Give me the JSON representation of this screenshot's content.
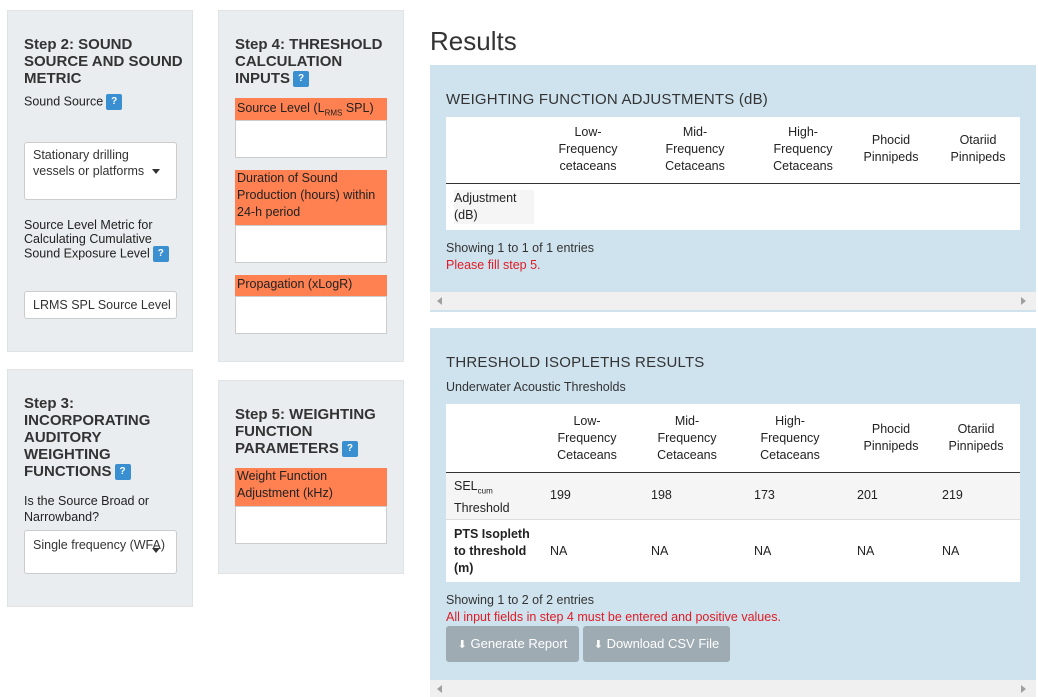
{
  "step2": {
    "title": "Step 2: SOUND SOURCE AND SOUND METRIC",
    "sound_source_label": "Sound Source",
    "sound_source_value": "Stationary drilling vessels or platforms",
    "metric_label": "Source Level Metric for Calculating Cumulative Sound Exposure Level",
    "metric_value": "LRMS SPL Source Level"
  },
  "step3": {
    "title": "Step 3: INCORPORATING AUDITORY WEIGHTING FUNCTIONS",
    "question": "Is the Source Broad or Narrowband?",
    "value": "Single frequency (WFA)"
  },
  "step4": {
    "title": "Step 4: THRESHOLD CALCULATION INPUTS",
    "source_level_label": "Source Level (L",
    "source_level_sub": "RMS",
    "source_level_suffix": " SPL)",
    "duration_label": "Duration of Sound Production (hours) within 24-h period",
    "propagation_label": "Propagation (xLogR)",
    "source_level_value": "",
    "duration_value": "",
    "propagation_value": ""
  },
  "step5": {
    "title": "Step 5: WEIGHTING FUNCTION PARAMETERS",
    "weight_label": "Weight Function Adjustment (kHz)",
    "weight_value": ""
  },
  "help_glyph": "?",
  "results": {
    "title": "Results",
    "weighting": {
      "heading": "WEIGHTING FUNCTION ADJUSTMENTS (dB)",
      "columns": [
        "Low-Frequency cetaceans",
        "Mid-Frequency Cetaceans",
        "High-Frequency Cetaceans",
        "Phocid Pinnipeds",
        "Otariid Pinnipeds"
      ],
      "row_label": "Adjustment (dB)",
      "info": "Showing 1 to 1 of 1 entries",
      "error": "Please fill step 5."
    },
    "threshold": {
      "heading": "THRESHOLD ISOPLETHS RESULTS",
      "subheading": "Underwater Acoustic Thresholds",
      "columns": [
        "Low-Frequency Cetaceans",
        "Mid-Frequency Cetaceans",
        "High-Frequency Cetaceans",
        "Phocid Pinnipeds",
        "Otariid Pinnipeds"
      ],
      "row1_label_main": "SEL",
      "row1_label_sub": "cum",
      "row1_label_rest": "Threshold",
      "row1_values": [
        "199",
        "198",
        "173",
        "201",
        "219"
      ],
      "row2_label": "PTS Isopleth to threshold (m)",
      "row2_values": [
        "NA",
        "NA",
        "NA",
        "NA",
        "NA"
      ],
      "info": "Showing 1 to 2 of 2 entries",
      "error": "All input fields in step 4 must be entered and positive values.",
      "generate_label": "Generate Report",
      "download_label": "Download CSV File"
    }
  },
  "colors": {
    "accent_orange": "#ff8050",
    "panel_bg": "#e9edef",
    "result_bg": "#cfe3ef",
    "help_blue": "#3a8fd1",
    "error_red": "#e01b24"
  },
  "icons": [
    "help-icon",
    "dropdown-caret-icon",
    "download-icon",
    "scroll-left-icon",
    "scroll-right-icon"
  ]
}
